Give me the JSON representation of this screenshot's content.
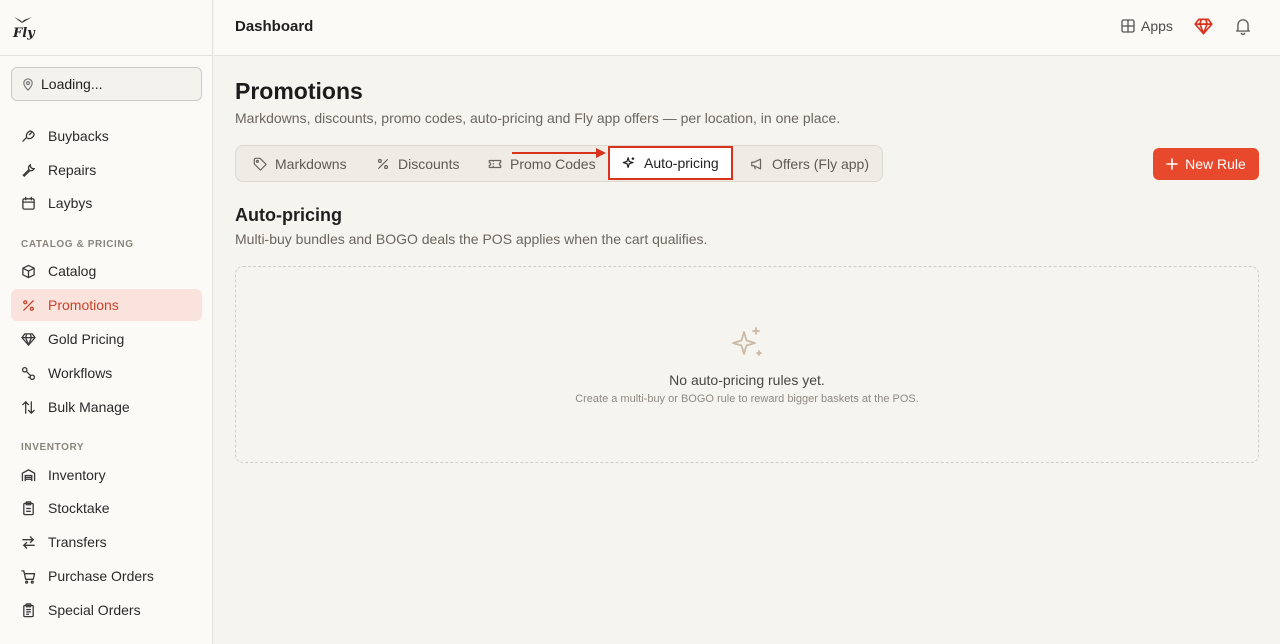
{
  "app": {
    "brand": "Fly"
  },
  "sidebar": {
    "location": "Loading...",
    "items_top": [
      {
        "label": "Buybacks",
        "icon": "buybacks-icon"
      },
      {
        "label": "Repairs",
        "icon": "wrench-icon"
      },
      {
        "label": "Laybys",
        "icon": "calendar-icon"
      }
    ],
    "sections": [
      {
        "label": "CATALOG & PRICING",
        "items": [
          {
            "label": "Catalog",
            "icon": "box-icon"
          },
          {
            "label": "Promotions",
            "icon": "percent-icon",
            "active": true
          },
          {
            "label": "Gold Pricing",
            "icon": "gem-icon"
          },
          {
            "label": "Workflows",
            "icon": "workflow-icon"
          },
          {
            "label": "Bulk Manage",
            "icon": "sort-arrows-icon"
          }
        ]
      },
      {
        "label": "INVENTORY",
        "items": [
          {
            "label": "Inventory",
            "icon": "warehouse-icon"
          },
          {
            "label": "Stocktake",
            "icon": "clipboard-icon"
          },
          {
            "label": "Transfers",
            "icon": "transfer-arrows-icon"
          },
          {
            "label": "Purchase Orders",
            "icon": "cart-icon"
          },
          {
            "label": "Special Orders",
            "icon": "clipboard-list-icon"
          }
        ]
      }
    ]
  },
  "topbar": {
    "title": "Dashboard",
    "apps_label": "Apps"
  },
  "page": {
    "title": "Promotions",
    "subtitle": "Markdowns, discounts, promo codes, auto-pricing and Fly app offers — per location, in one place."
  },
  "tabs": [
    {
      "label": "Markdowns",
      "icon": "tag-icon"
    },
    {
      "label": "Discounts",
      "icon": "percent-icon"
    },
    {
      "label": "Promo Codes",
      "icon": "ticket-icon"
    },
    {
      "label": "Auto-pricing",
      "icon": "sparkles-icon",
      "active": true
    },
    {
      "label": "Offers (Fly app)",
      "icon": "megaphone-icon"
    }
  ],
  "actions": {
    "new_rule": "New Rule"
  },
  "section": {
    "title": "Auto-pricing",
    "description": "Multi-buy bundles and BOGO deals the POS applies when the cart qualifies."
  },
  "empty_state": {
    "title": "No auto-pricing rules yet.",
    "description": "Create a multi-buy or BOGO rule to reward bigger baskets at the POS."
  },
  "colors": {
    "accent": "#e8492c",
    "active_nav_bg": "#f9e3dc",
    "active_nav_text": "#c9432b",
    "highlight_border": "#d9331e",
    "page_bg": "#f6f4ef"
  }
}
